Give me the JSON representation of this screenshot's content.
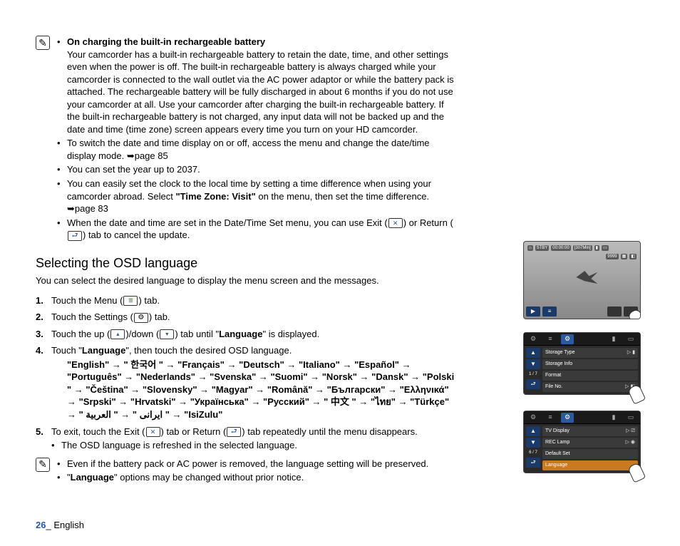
{
  "notes_top": {
    "title": "On charging the built-in rechargeable battery",
    "body": "Your camcorder has a built-in rechargeable battery to retain the date, time, and other settings even when the power is off. The built-in rechargeable battery is always charged while your camcorder is connected to the wall outlet via the AC power adaptor or while the battery pack is attached. The rechargeable battery will be fully discharged in about 6 months if you do not use your camcorder at all. Use your camcorder after charging the built-in rechargeable battery. If the built-in rechargeable battery is not charged, any input data will not be backed up and the date and time (time zone) screen appears every time you turn on your HD camcorder.",
    "b2": "To switch the date and time display on or off, access the menu and change the date/time display mode. ➥page 85",
    "b3": "You can set the year up to 2037.",
    "b4a": "You can easily set the clock to the local time by setting a time difference when using your camcorder abroad. Select ",
    "b4bold": "\"Time Zone: Visit\"",
    "b4b": " on the menu, then set the time difference. ➥page 83",
    "b5a": "When the date and time are set in the Date/Time Set menu, you can use Exit (",
    "b5b": ") or Return (",
    "b5c": ") tab to cancel the update."
  },
  "section_title": "Selecting the OSD language",
  "intro": "You can select the desired language to display the menu screen and the messages.",
  "steps": {
    "s1a": "Touch the Menu (",
    "s1b": ") tab.",
    "s2a": "Touch the Settings (",
    "s2b": ") tab.",
    "s3a": "Touch the up (",
    "s3b": ")/down (",
    "s3c": ") tab until \"",
    "s3bold": "Language",
    "s3d": "\" is displayed.",
    "s4a": "Touch \"",
    "s4bold": "Language",
    "s4b": "\", then touch the desired OSD language.",
    "lang_line": "\"English\" → \" 한국어 \" → \"Français\" → \"Deutsch\" → \"Italiano\" → \"Español\" → \"Português\" → \"Nederlands\" → \"Svenska\" → \"Suomi\" → \"Norsk\" → \"Dansk\" → \"Polski \" → \"Čeština\" → \"Slovensky\" → \"Magyar\" → \"Română\" → \"Български\" → \"Ελληνικά\" → \"Srpski\" → \"Hrvatski\" → \"Українська\" → \"Русский\" → \" 中文 \" → \"ไทย\" → \"Türkçe\" → \" ایرانی \" → \" العربية \" → \"IsiZulu\"",
    "s5a": "To exit, touch the Exit (",
    "s5b": ") tab or Return (",
    "s5c": ") tab repeatedly until the menu disappears.",
    "s5sub": "The OSD language is refreshed in the selected language."
  },
  "notes_bottom": {
    "b1": "Even if the battery pack or AC power is removed, the language setting will be preserved.",
    "b2a": "\"",
    "b2bold": "Language",
    "b2b": "\" options may be changed without prior notice."
  },
  "footer": {
    "page": "26",
    "sep": "_ ",
    "lang": "English"
  },
  "screen_photo": {
    "stby": "STBY",
    "time": "00:00:00",
    "remain": "[307Min]",
    "count": "9999"
  },
  "settings1": {
    "counter": "1 / 7",
    "rows": [
      "Storage Type",
      "Storage Info",
      "Format",
      "File No."
    ]
  },
  "settings2": {
    "counter": "6 / 7",
    "rows": [
      "TV Display",
      "REC Lamp",
      "Default Set",
      "Language"
    ]
  }
}
